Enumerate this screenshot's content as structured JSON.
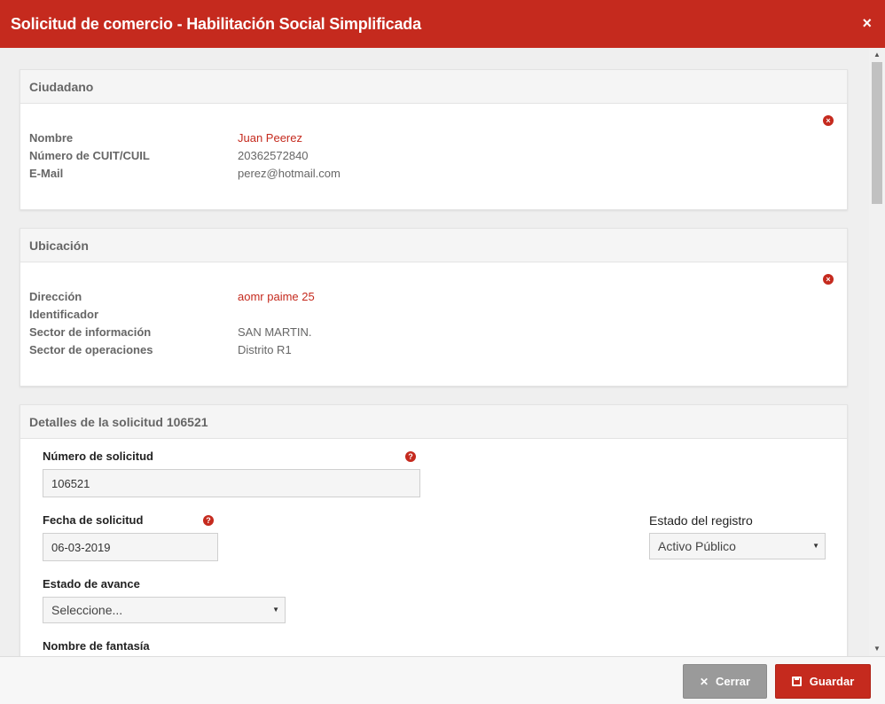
{
  "modal": {
    "title": "Solicitud de comercio - Habilitación Social Simplificada",
    "close_glyph": "×"
  },
  "ciudadano": {
    "heading": "Ciudadano",
    "fields": [
      {
        "label": "Nombre",
        "value": "Juan Peerez"
      },
      {
        "label": "Número de CUIT/CUIL",
        "value": "20362572840"
      },
      {
        "label": "E-Mail",
        "value": "perez@hotmail.com"
      }
    ]
  },
  "ubicacion": {
    "heading": "Ubicación",
    "fields": [
      {
        "label": "Dirección",
        "value": "aomr paime 25"
      },
      {
        "label": "Identificador",
        "value": ""
      },
      {
        "label": "Sector de información",
        "value": "SAN MARTIN."
      },
      {
        "label": "Sector de operaciones",
        "value": "Distrito R1"
      }
    ]
  },
  "detalles": {
    "heading": "Detalles de la solicitud 106521",
    "numero_label": "Número de solicitud",
    "numero_value": "106521",
    "fecha_label": "Fecha de solicitud",
    "fecha_value": "06-03-2019",
    "estado_registro_label": "Estado del registro",
    "estado_registro_value": "Activo Público",
    "estado_avance_label": "Estado de avance",
    "estado_avance_value": "Seleccione...",
    "nombre_fantasia_label": "Nombre de fantasía"
  },
  "footer": {
    "close_label": "Cerrar",
    "save_label": "Guardar"
  },
  "colors": {
    "brand": "#c52a1e",
    "neutral_button": "#9a9a9a"
  },
  "icons": {
    "remove": "circle-x-icon",
    "help": "question-circle-icon",
    "save": "floppy-disk-icon",
    "close": "x-icon",
    "dropdown": "caret-down-icon"
  }
}
